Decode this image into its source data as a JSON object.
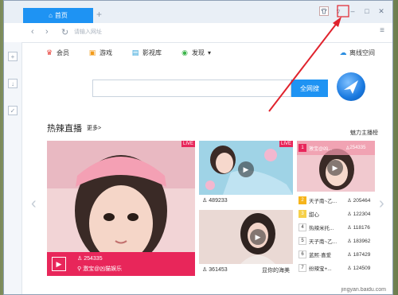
{
  "tab": {
    "label": "首页",
    "add": "+"
  },
  "window_controls": [
    "shirt-icon",
    "menu-icon",
    "minimize-icon",
    "maximize-icon",
    "close-icon"
  ],
  "address": {
    "placeholder": "请输入网址",
    "back": "‹",
    "forward": "›",
    "refresh": "↻",
    "menu": "≡"
  },
  "sidebar": {
    "items": [
      "+",
      "↓",
      "✓"
    ]
  },
  "nav": {
    "links": [
      {
        "icon": "crown-icon",
        "label": "会员"
      },
      {
        "icon": "game-icon",
        "label": "游戏"
      },
      {
        "icon": "video-icon",
        "label": "影视库"
      },
      {
        "icon": "discover-icon",
        "label": "发现"
      }
    ],
    "discover_caret": "▾",
    "offline": "离线空间"
  },
  "search": {
    "button": "全网搜"
  },
  "section": {
    "title": "热辣直播",
    "more": "更多>",
    "right": "魅力主播榜"
  },
  "arrows": {
    "left": "‹",
    "right": "›"
  },
  "big_card": {
    "live": "LIVE",
    "viewers": "254335",
    "room": "激宝@凶猫娱乐"
  },
  "card_top": {
    "live": "LIVE",
    "viewers": "489233"
  },
  "card_bottom": {
    "viewers": "361453",
    "room": "显你的海美"
  },
  "rank": {
    "top": {
      "num": "1",
      "name": "激宝@凶...",
      "count": "254335"
    },
    "rows": [
      {
        "num": "2",
        "name": "天子南~乙...",
        "count": "205464"
      },
      {
        "num": "3",
        "name": "甜心",
        "count": "122304"
      },
      {
        "num": "4",
        "name": "热辣米托...",
        "count": "118176"
      },
      {
        "num": "5",
        "name": "天子南~乙...",
        "count": "183962"
      },
      {
        "num": "6",
        "name": "蓝熙·喜爱",
        "count": "187429"
      },
      {
        "num": "7",
        "name": "纷辣宝+...",
        "count": "124509"
      }
    ]
  },
  "watermark": "jingyan.baidu.com",
  "colors": {
    "accent": "#1e93f3",
    "live": "#e8265a",
    "annotation": "#e0232d"
  }
}
